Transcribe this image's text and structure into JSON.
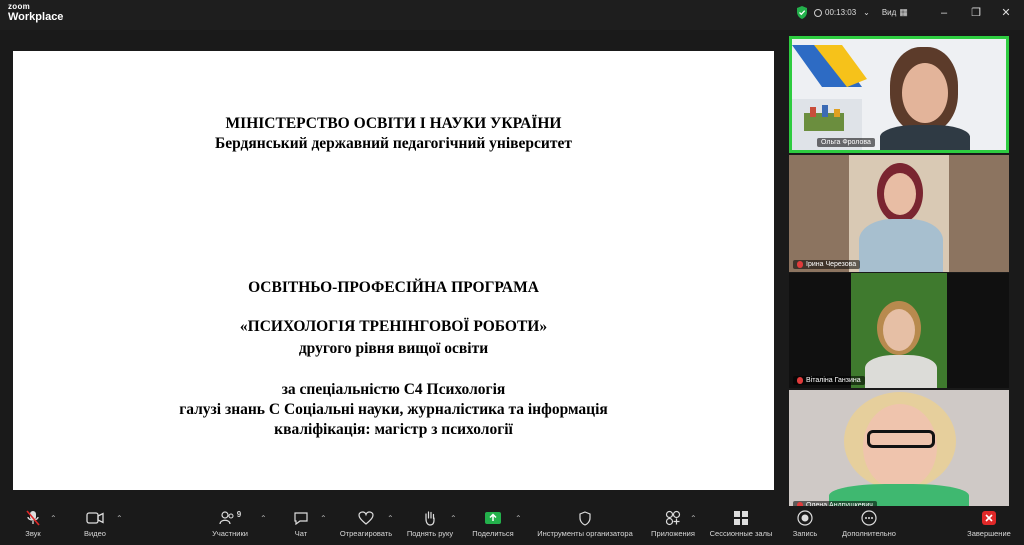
{
  "app": {
    "brand_small": "zoom",
    "brand_large": "Workplace"
  },
  "titlebar": {
    "timer": "00:13:03",
    "view_label": "Вид"
  },
  "slide": {
    "line1": "МІНІСТЕРСТВО ОСВІТИ І НАУКИ УКРАЇНИ",
    "line2": "Бердянський державний педагогічний університет",
    "line3": "ОСВІТНЬО-ПРОФЕСІЙНА ПРОГРАМА",
    "line4": "«ПСИХОЛОГІЯ ТРЕНІНГОВОЇ РОБОТИ»",
    "line5": "другого рівня вищої освіти",
    "line6": "за спеціальністю С4 Психологія",
    "line7": "галузі знань С Соціальні науки, журналістика та інформація",
    "line8": "кваліфікація: магістр з психології"
  },
  "participants": [
    {
      "name": "Ольга Фролова",
      "muted": false,
      "active": true
    },
    {
      "name": "Ірина Черезова",
      "muted": true,
      "active": false
    },
    {
      "name": "Віталіна Ганзина",
      "muted": true,
      "active": false
    },
    {
      "name": "Олена Андрушкевич",
      "muted": true,
      "active": false
    }
  ],
  "toolbar": {
    "audio": "Звук",
    "video": "Видео",
    "participants": "Участники",
    "participants_count": "9",
    "chat": "Чат",
    "react": "Отреагировать",
    "raise_hand": "Поднять руку",
    "share": "Поделиться",
    "host_tools": "Инструменты организатора",
    "apps": "Приложения",
    "breakout": "Сессионные залы",
    "record": "Запись",
    "more": "Дополнительно",
    "end": "Завершение"
  },
  "colors": {
    "active_border": "#2ecc40",
    "end_red": "#e02828",
    "share_green": "#23b04b"
  }
}
